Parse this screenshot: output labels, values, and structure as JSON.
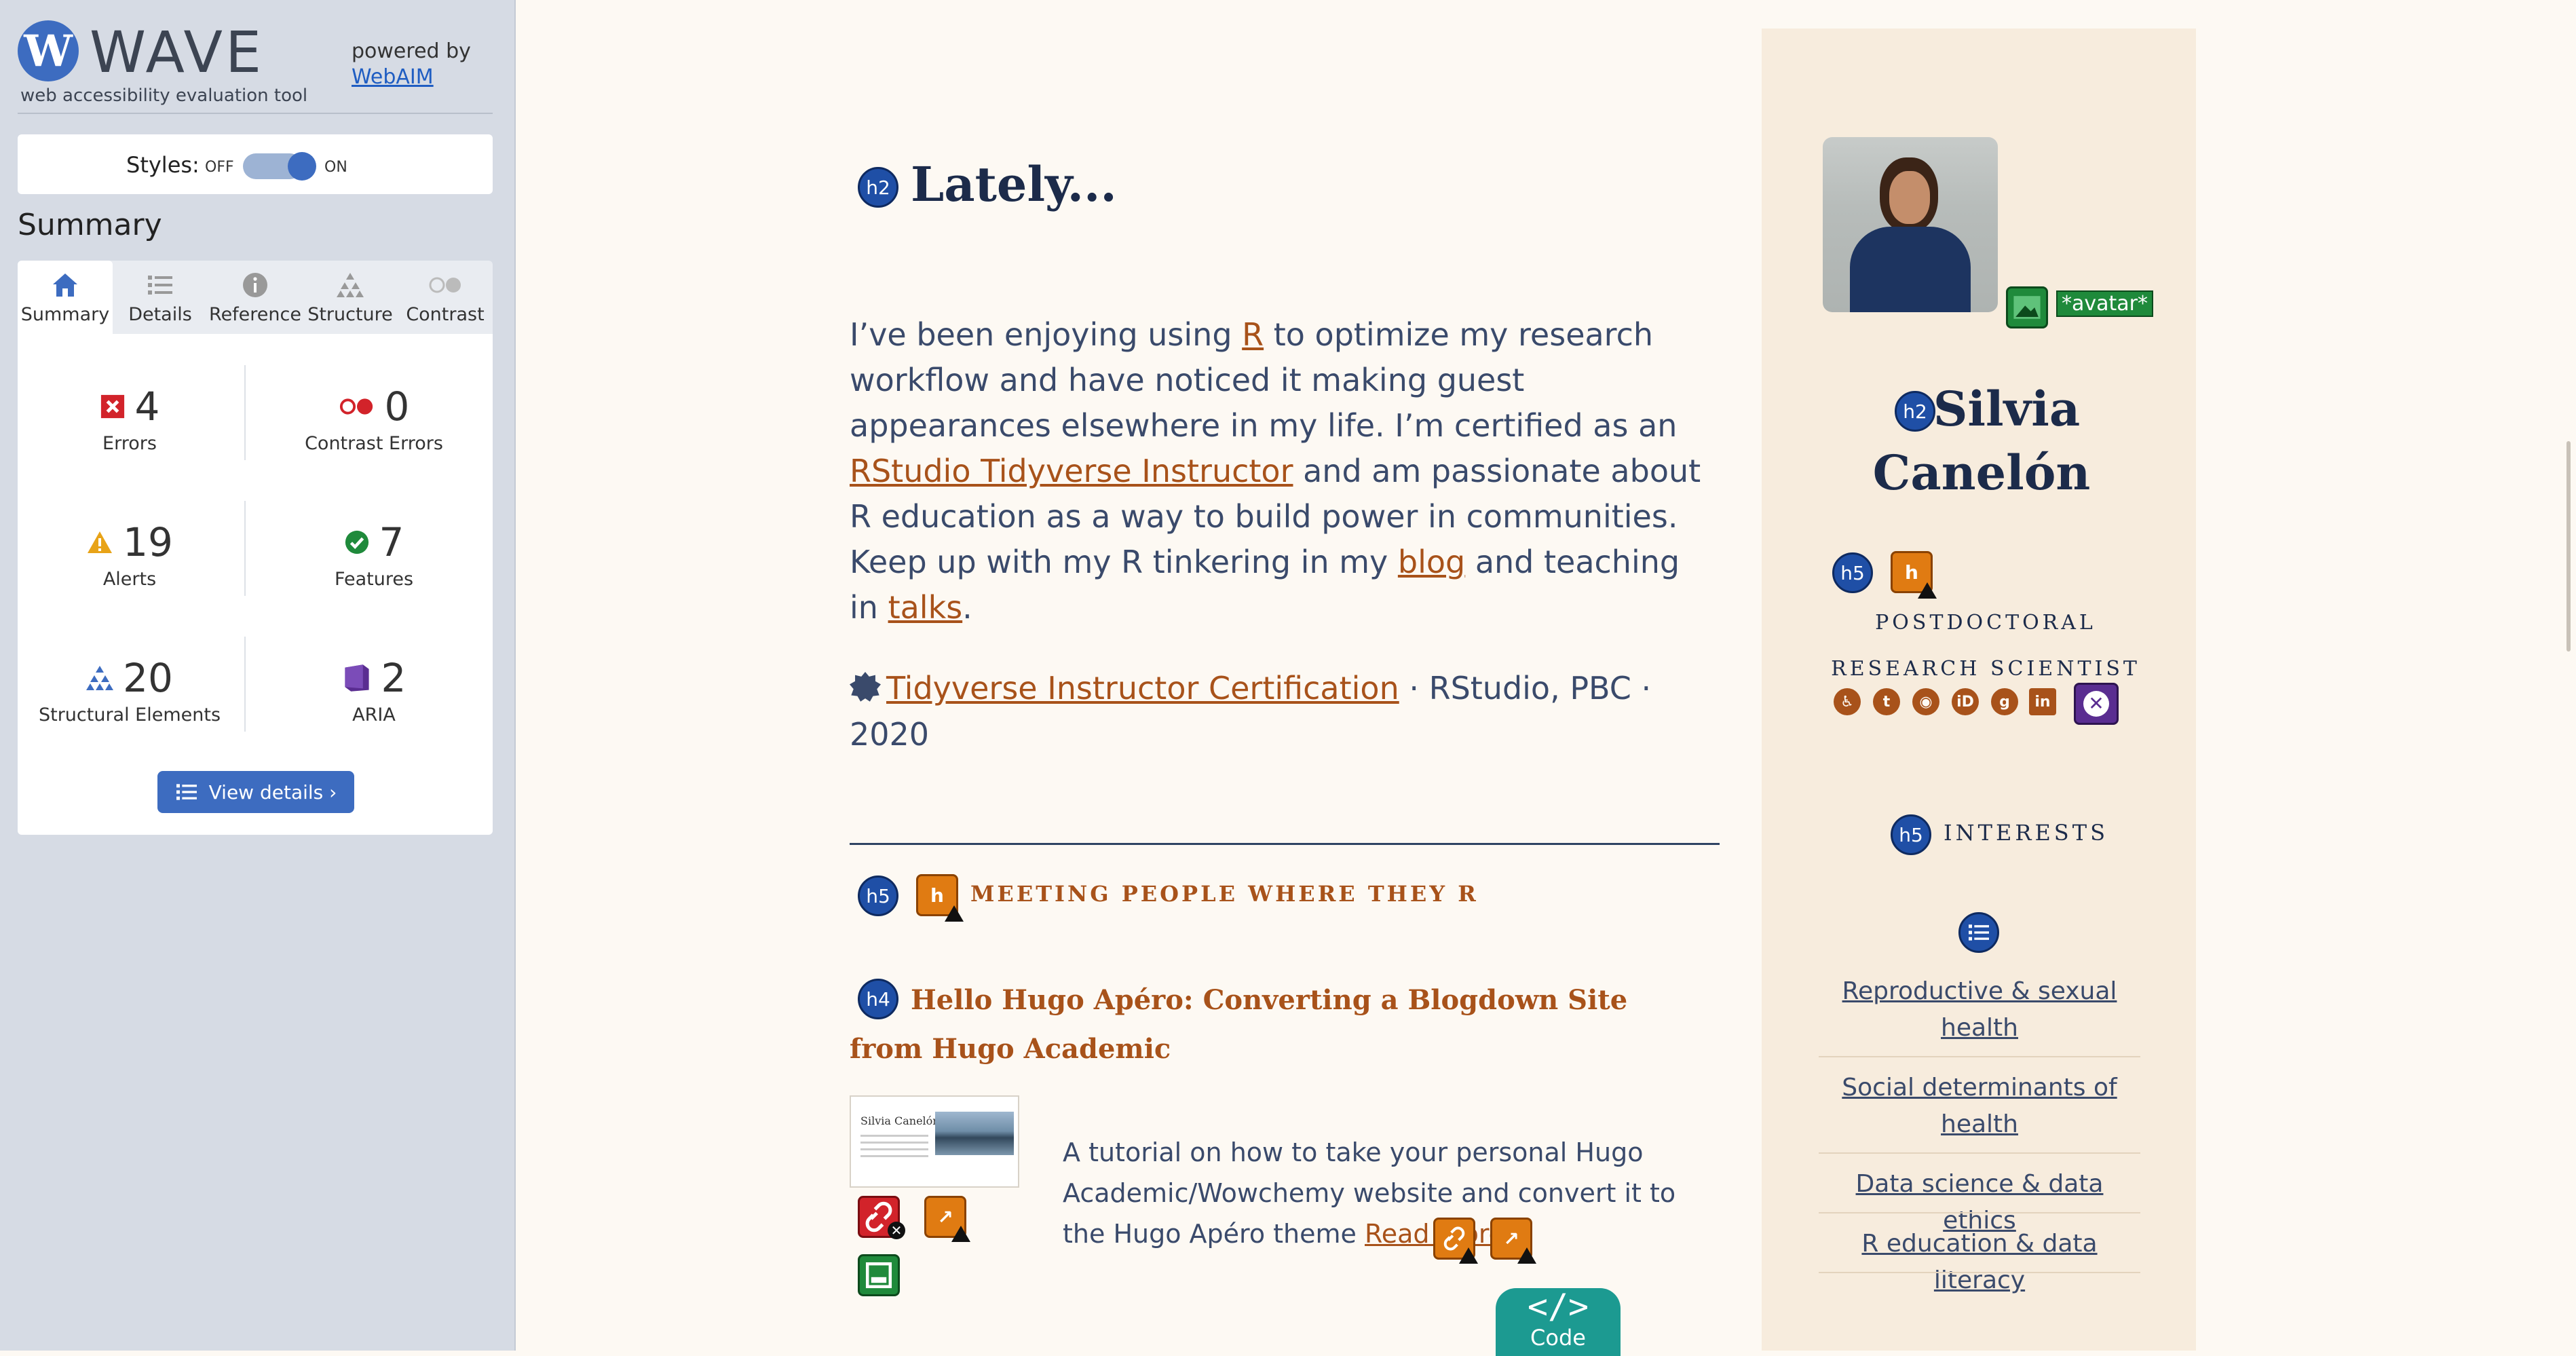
{
  "wave": {
    "logo_letter": "W",
    "logo_word": "WAVE",
    "tagline": "web accessibility evaluation tool",
    "powered_by": "powered by",
    "webaim_link": "WebAIM",
    "styles_label": "Styles:",
    "off_label": "OFF",
    "on_label": "ON",
    "summary_title": "Summary",
    "tabs": [
      {
        "label": "Summary",
        "icon": "home-icon"
      },
      {
        "label": "Details",
        "icon": "list-icon"
      },
      {
        "label": "Reference",
        "icon": "info-icon"
      },
      {
        "label": "Structure",
        "icon": "hierarchy-icon"
      },
      {
        "label": "Contrast",
        "icon": "contrast-icon"
      }
    ],
    "stats": {
      "errors": {
        "count": "4",
        "label": "Errors"
      },
      "contrast": {
        "count": "0",
        "label": "Contrast Errors"
      },
      "alerts": {
        "count": "19",
        "label": "Alerts"
      },
      "features": {
        "count": "7",
        "label": "Features"
      },
      "structural": {
        "count": "20",
        "label": "Structural Elements"
      },
      "aria": {
        "count": "2",
        "label": "ARIA"
      }
    },
    "view_details": "View details ›",
    "colors": {
      "accent": "#3d6cc0",
      "error": "#d2232a",
      "alert": "#e8a317",
      "feature": "#1f8a3b",
      "aria": "#5a2d91"
    }
  },
  "page": {
    "h2_badge": "h2",
    "h5_badge": "h5",
    "h4_badge": "h4",
    "lately_heading": "Lately...",
    "para": {
      "t1": "I’ve been enjoying using ",
      "link_r": "R",
      "t2": " to optimize my research workflow and have noticed it making guest appearances elsewhere in my life. I’m certified as an ",
      "link_instructor": "RStudio Tidyverse Instructor",
      "t3": " and am passionate about R education as a way to build power in communities. Keep up with my R tinkering in my ",
      "link_blog": "blog",
      "t4": " and teaching in ",
      "link_talks": "talks",
      "t5": "."
    },
    "cert": {
      "link": "Tidyverse Instructor Certification",
      "rest": " · RStudio, PBC · 2020"
    },
    "section_label": "MEETING PEOPLE WHERE THEY R",
    "post_title": "Hello Hugo Apéro: Converting a Blogdown Site from Hugo Academic",
    "thumb_name": "Silvia Canelón",
    "post_desc": "A tutorial on how to take your personal Hugo Academic/Wowchemy website and convert it to the Hugo Apéro theme ",
    "read_more": "Read more",
    "code_glyph": "</>",
    "code_label": "Code",
    "colors": {
      "link": "#a8521a",
      "text": "#3a4a6b",
      "heading": "#1c2b4a",
      "background": "#fdf9f3"
    }
  },
  "profile": {
    "avatar_alt": "*avatar*",
    "name": "Silvia Canelón",
    "role": "POSTDOCTORAL RESEARCH SCIENTIST",
    "social_icons": [
      "accessibility-icon",
      "twitter-icon",
      "github-icon",
      "orcid-icon",
      "google-scholar-icon",
      "linkedin-icon"
    ],
    "interests_heading": "INTERESTS",
    "interests": [
      "Reproductive & sexual health",
      "Social determinants of health",
      "Data science & data ethics",
      "R education & data literacy"
    ]
  }
}
